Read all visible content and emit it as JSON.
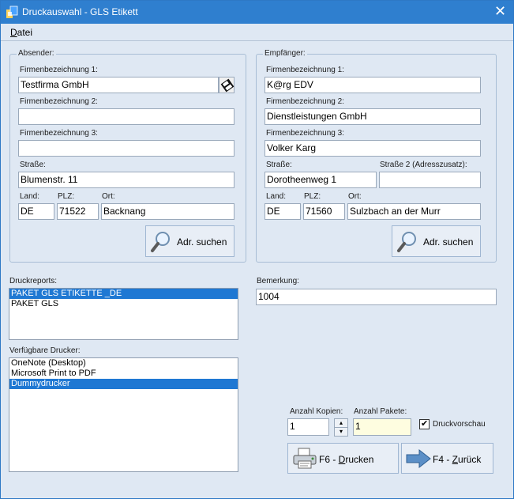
{
  "window": {
    "title": "Druckauswahl - GLS Etikett",
    "close_symbol": "✕"
  },
  "menu": {
    "datei_first": "D",
    "datei_rest": "atei"
  },
  "absender": {
    "legend": "Absender:",
    "firma1_label": "Firmenbezeichnung 1:",
    "firma1": "Testfirma GmbH",
    "firma2_label": "Firmenbezeichnung 2:",
    "firma2": "",
    "firma3_label": "Firmenbezeichnung 3:",
    "firma3": "",
    "strasse_label": "Straße:",
    "strasse": "Blumenstr. 11",
    "land_label": "Land:",
    "land": "DE",
    "plz_label": "PLZ:",
    "plz": "71522",
    "ort_label": "Ort:",
    "ort": "Backnang",
    "search_button": "Adr. suchen"
  },
  "empfaenger": {
    "legend": "Empfänger:",
    "firma1_label": "Firmenbezeichnung 1:",
    "firma1": "K@rg EDV",
    "firma2_label": "Firmenbezeichnung 2:",
    "firma2": "Dienstleistungen GmbH",
    "firma3_label": "Firmenbezeichnung 3:",
    "firma3": "Volker Karg",
    "strasse_label": "Straße:",
    "strasse": "Dorotheenweg 1",
    "strasse2_label": "Straße 2 (Adresszusatz):",
    "strasse2": "",
    "land_label": "Land:",
    "land": "DE",
    "plz_label": "PLZ:",
    "plz": "71560",
    "ort_label": "Ort:",
    "ort": "Sulzbach an der Murr",
    "search_button": "Adr. suchen"
  },
  "druckreports": {
    "label": "Druckreports:",
    "items": [
      "PAKET GLS ETIKETTE _DE",
      "PAKET GLS"
    ],
    "selected_index": 0
  },
  "bemerkung": {
    "label": "Bemerkung:",
    "value": "1004"
  },
  "drucker": {
    "label": "Verfügbare Drucker:",
    "items": [
      "OneNote (Desktop)",
      "Microsoft Print to PDF",
      "Dummydrucker"
    ],
    "selected_index": 2
  },
  "kopien": {
    "label": "Anzahl Kopien:",
    "value": "1"
  },
  "pakete": {
    "label": "Anzahl Pakete:",
    "value": "1"
  },
  "druckvorschau": {
    "label": "Druckvorschau",
    "checked": true,
    "check_symbol": "✔"
  },
  "drucken_button": {
    "prefix": "F6 - ",
    "mnemonic": "D",
    "rest": "rucken"
  },
  "zurueck_button": {
    "prefix": "F4 - ",
    "mnemonic": "Z",
    "rest": "urück"
  },
  "colors": {
    "titlebar": "#2f7fcf",
    "background": "#dfe8f3",
    "selection": "#1f78d3",
    "highlight_input": "#fefde0"
  }
}
